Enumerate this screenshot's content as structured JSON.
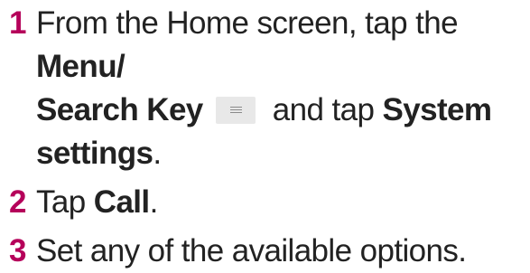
{
  "colors": {
    "step_number": "#b5005a",
    "text": "#222222",
    "key_icon_bg": "#e8e8e8"
  },
  "steps": [
    {
      "number": "1",
      "text_a": "From the Home screen, tap the ",
      "bold_a": "Menu/",
      "bold_b": "Search Key",
      "icon": "menu-lines-icon",
      "text_b": " and tap ",
      "bold_c": "System",
      "bold_d": "settings",
      "text_c": "."
    },
    {
      "number": "2",
      "text_a": "Tap ",
      "bold_a": "Call",
      "text_b": "."
    },
    {
      "number": "3",
      "text_a": "Set any of the available options."
    }
  ]
}
